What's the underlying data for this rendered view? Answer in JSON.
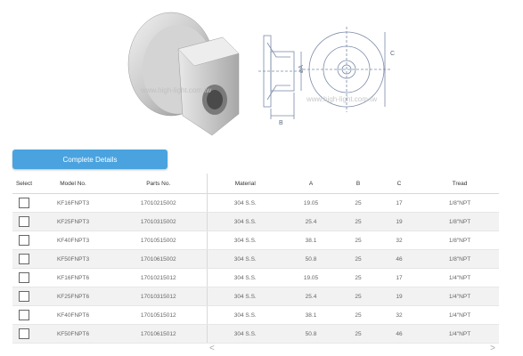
{
  "hero": {
    "watermark": "www.high-light.com.tw",
    "dimension_labels": {
      "a": "øA",
      "b": "B",
      "c": "C"
    }
  },
  "details_button": {
    "label": "Complete Details"
  },
  "table": {
    "headers": {
      "select": "Select",
      "model": "Model No.",
      "parts": "Parts No.",
      "material": "Material",
      "a": "A",
      "b": "B",
      "c": "C",
      "tread": "Tread"
    },
    "rows": [
      {
        "model": "KF16FNPT3",
        "parts": "17010215002",
        "material": "304 S.S.",
        "a": "19.05",
        "b": "25",
        "c": "17",
        "tread": "1/8\"NPT"
      },
      {
        "model": "KF25FNPT3",
        "parts": "17010315002",
        "material": "304 S.S.",
        "a": "25.4",
        "b": "25",
        "c": "19",
        "tread": "1/8\"NPT"
      },
      {
        "model": "KF40FNPT3",
        "parts": "17010515002",
        "material": "304 S.S.",
        "a": "38.1",
        "b": "25",
        "c": "32",
        "tread": "1/8\"NPT"
      },
      {
        "model": "KF50FNPT3",
        "parts": "17010615002",
        "material": "304 S.S.",
        "a": "50.8",
        "b": "25",
        "c": "46",
        "tread": "1/8\"NPT"
      },
      {
        "model": "KF16FNPT6",
        "parts": "17010215012",
        "material": "304 S.S.",
        "a": "19.05",
        "b": "25",
        "c": "17",
        "tread": "1/4\"NPT"
      },
      {
        "model": "KF25FNPT6",
        "parts": "17010315012",
        "material": "304 S.S.",
        "a": "25.4",
        "b": "25",
        "c": "19",
        "tread": "1/4\"NPT"
      },
      {
        "model": "KF40FNPT6",
        "parts": "17010515012",
        "material": "304 S.S.",
        "a": "38.1",
        "b": "25",
        "c": "32",
        "tread": "1/4\"NPT"
      },
      {
        "model": "KF50FNPT6",
        "parts": "17010615012",
        "material": "304 S.S.",
        "a": "50.8",
        "b": "25",
        "c": "46",
        "tread": "1/4\"NPT"
      }
    ]
  },
  "scrollbar": {
    "left": "<",
    "right": ">"
  }
}
